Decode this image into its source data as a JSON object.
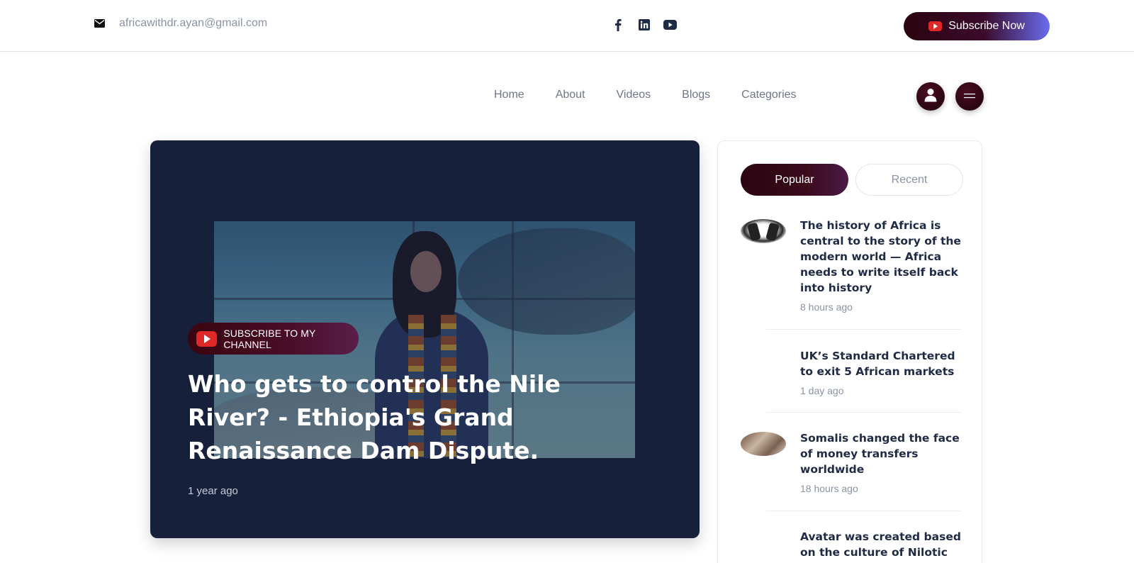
{
  "topbar": {
    "email": "africawithdr.ayan@gmail.com",
    "icons": {
      "mail": "envelope-icon",
      "facebook": "facebook-icon",
      "linkedin": "linkedin-icon",
      "youtube": "youtube-icon"
    },
    "subscribe_label": "Subscribe Now"
  },
  "nav": {
    "items": [
      "Home",
      "About",
      "Videos",
      "Blogs",
      "Categories"
    ],
    "user_icon": "user-icon",
    "menu_icon": "hamburger-menu-icon"
  },
  "hero": {
    "channel_label": "SUBSCRIBE TO MY CHANNEL",
    "title": "Who gets to control the Nile River? - Ethiopia's Grand Renaissance Dam Dispute.",
    "time": "1 year ago"
  },
  "sidebar": {
    "tabs": [
      "Popular",
      "Recent"
    ],
    "active_tab": "Popular",
    "posts": [
      {
        "title": "The history of Africa is central to the story of the modern world — Africa needs to write itself back into history",
        "time": "8 hours ago"
      },
      {
        "title": "UK’s Standard Chartered to exit 5 African markets",
        "time": "1 day ago"
      },
      {
        "title": "Somalis changed the face of money transfers worldwide",
        "time": "18 hours ago"
      },
      {
        "title": "Avatar was created based on the culture of Nilotic",
        "time": ""
      }
    ]
  },
  "colors": {
    "brand_dark": "#2a0510",
    "brand_gradient_end": "#6a6cf0",
    "hero_bg": "#16203a",
    "youtube_red": "#e02828",
    "heading": "#1f2a44",
    "muted": "#8a93a3"
  }
}
